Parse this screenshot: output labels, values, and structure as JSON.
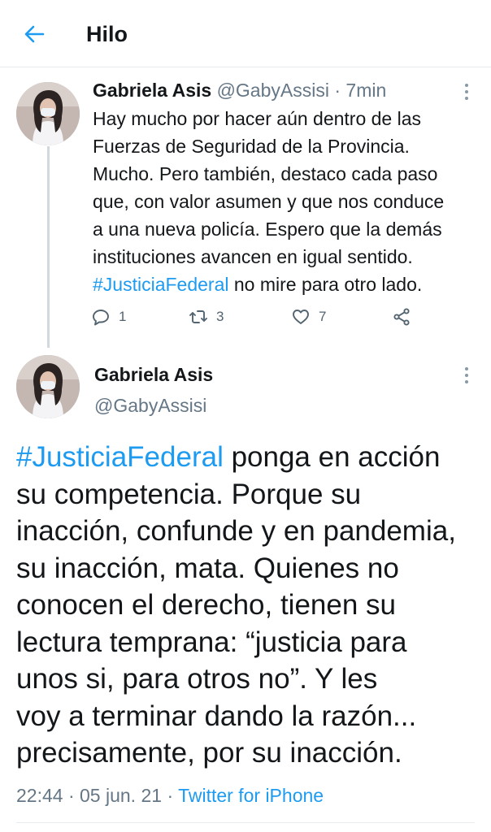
{
  "header": {
    "title": "Hilo",
    "back_icon": "arrow-left-icon"
  },
  "colors": {
    "accent": "#1d9bf0",
    "muted": "#657786",
    "text": "#14171a"
  },
  "tweet1": {
    "name": "Gabriela Asis",
    "handle": "@GabyAssisi",
    "separator": "·",
    "time": "7min",
    "text_lines": [
      "Hay mucho por hacer aún dentro de las",
      "Fuerzas de Seguridad de la Provincia.",
      "Mucho. Pero también, destaco cada paso",
      "que, con valor asumen y que nos conduce",
      "a una nueva policía. Espero que la demás",
      "instituciones avancen en igual sentido."
    ],
    "hashtag": "#JusticiaFederal",
    "text_tail": " no mire para otro lado.",
    "replies": "1",
    "retweets": "3",
    "likes": "7"
  },
  "tweet2": {
    "name": "Gabriela Asis",
    "handle": "@GabyAssisi",
    "hashtag": "#JusticiaFederal",
    "first_line_rest": " ponga en acción",
    "lines": [
      "su competencia. Porque su",
      "inacción, confunde y en pandemia,",
      "su inacción, mata. Quienes no",
      "conocen el derecho, tienen su",
      "lectura temprana: “justicia para",
      "unos si, para otros no”. Y les",
      "voy a terminar dando la razón...",
      "precisamente, por su inacción."
    ],
    "time": "22:44",
    "separator": "·",
    "date": "05 jun. 21",
    "source": "Twitter for iPhone"
  }
}
